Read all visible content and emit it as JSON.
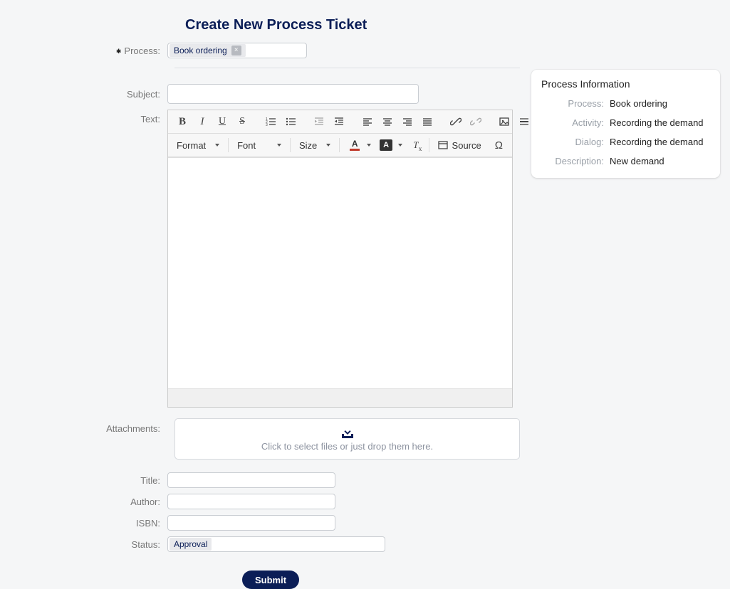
{
  "title": "Create New Process Ticket",
  "process": {
    "label": "Process:",
    "chip": "Book ordering"
  },
  "form": {
    "subject_label": "Subject:",
    "text_label": "Text:",
    "attachments_label": "Attachments:",
    "drop_hint": "Click to select files or just drop them here.",
    "title_label": "Title:",
    "author_label": "Author:",
    "isbn_label": "ISBN:",
    "status_label": "Status:",
    "status_value": "Approval",
    "submit": "Submit"
  },
  "toolbar": {
    "format": "Format",
    "font": "Font",
    "size": "Size",
    "source": "Source"
  },
  "info": {
    "heading": "Process Information",
    "process_label": "Process:",
    "process_value": "Book ordering",
    "activity_label": "Activity:",
    "activity_value": "Recording the demand",
    "dialog_label": "Dialog:",
    "dialog_value": "Recording the demand",
    "description_label": "Description:",
    "description_value": "New demand"
  }
}
